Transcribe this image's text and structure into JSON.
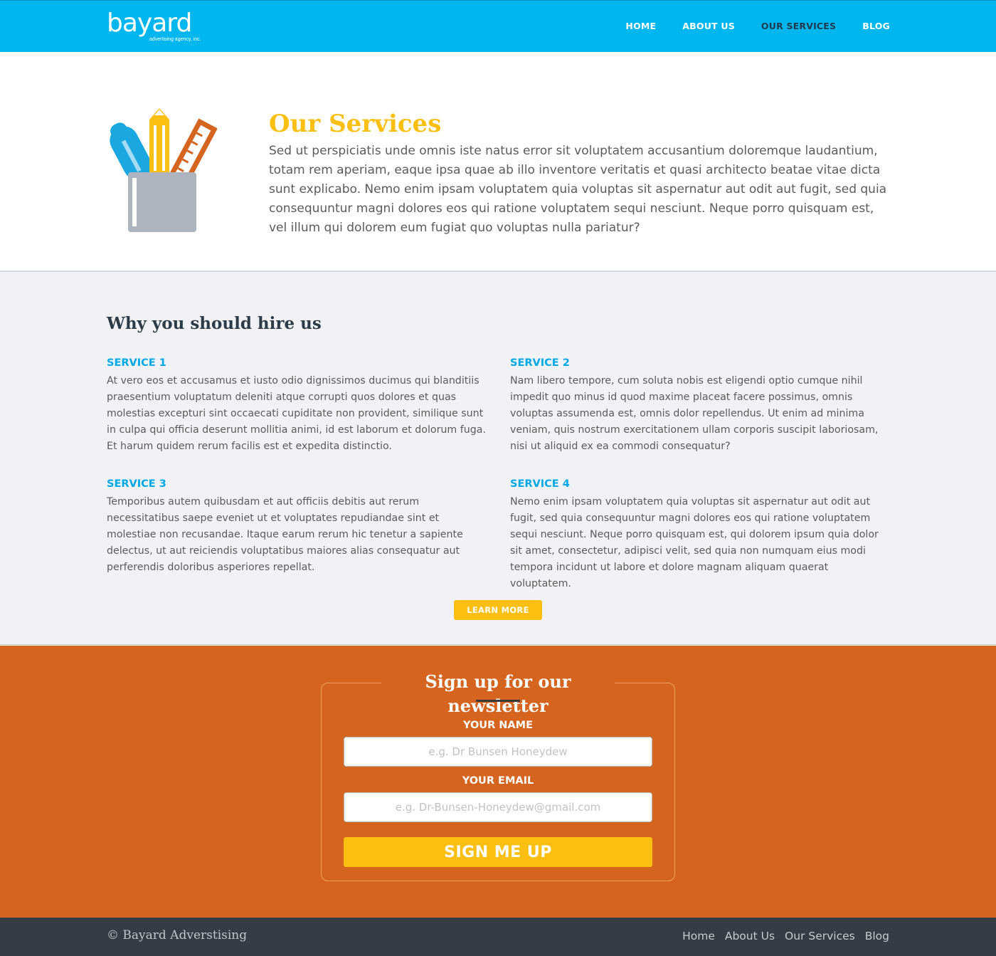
{
  "header": {
    "logo_word": "bayard",
    "logo_tagline": "advertising agency, inc.",
    "nav": [
      {
        "label": "HOME"
      },
      {
        "label": "ABOUT US"
      },
      {
        "label": "OUR SERVICES"
      },
      {
        "label": "BLOG"
      }
    ],
    "active_nav": "OUR SERVICES"
  },
  "hero": {
    "icon": "pencil-ruler-cup-icon",
    "title": "Our Services",
    "text": "Sed ut perspiciatis unde omnis iste natus error sit voluptatem accusantium doloremque laudantium, totam rem aperiam, eaque ipsa quae ab illo inventore veritatis et quasi architecto beatae vitae dicta sunt explica­bo. Nemo enim ipsam voluptatem quia voluptas sit aspernatur aut odit aut fugit, sed quia consequuntur magni dolores eos qui ratione voluptatem sequi nesciunt. Neque porro quisquam est, vel illum qui dolorem eum fugiat quo voluptas nulla pariatur?"
  },
  "services": {
    "heading": "Why you should hire us",
    "items": [
      {
        "title": "SERVICE 1",
        "text": "At vero eos et accusamus et iusto odio dignissimos ducimus qui blanditiis praesentium voluptatum deleniti atque corrupti quos dolores et quas molestias excepturi sint occaecati cupiditate non provident, similique sunt in culpa qui officia deserunt mollitia animi, id est laborum et dolorum fuga. Et harum quidem rerum facilis est et expedita distinctio."
      },
      {
        "title": "SERVICE 2",
        "text": "Nam libero tempore, cum soluta nobis est eligendi optio cumque nihil impedit quo minus id quod maxime placeat facere possimus, omnis voluptas assumenda est, omnis dolor repellendus. Ut enim ad minima veniam, quis nostrum exercitationem ullam corporis suscipit laboriosam, nisi ut aliquid ex ea commodi consequatur?"
      },
      {
        "title": "SERVICE 3",
        "text": "Temporibus autem quibusdam et aut officiis debitis aut rerum necessitatibus saepe eveniet ut et voluptates repudiandae sint et molestiae non recusandae. Itaque earum rerum hic tenetur a sapiente delectus, ut aut reiciendis voluptatibus maiores alias consequatur aut perferendis doloribus asperiores repellat."
      },
      {
        "title": "SERVICE 4",
        "text": "Nemo enim ipsam voluptatem quia voluptas sit aspernatur aut odit aut fugit, sed quia consequuntur magni dolores eos qui ratione voluptatem sequi nesciunt. Neque porro quisquam est, qui dolorem ipsum quia dolor sit amet, consectetur, adipisci velit, sed quia non numquam eius modi tempora incidunt ut labore et dolore magnam aliquam quaerat voluptatem."
      }
    ],
    "learn_more_label": "LEARN MORE"
  },
  "newsletter": {
    "title": "Sign up for our newsletter",
    "name_label": "YOUR NAME",
    "name_placeholder": "e.g. Dr Bunsen Honeydew",
    "name_value": "",
    "email_label": "YOUR EMAIL",
    "email_placeholder": "e.g. Dr-Bunsen-Honeydew@gmail.com",
    "email_value": "",
    "submit_label": "SIGN ME UP"
  },
  "footer": {
    "copyright": "© Bayard Adverstising",
    "links": [
      {
        "label": "Home"
      },
      {
        "label": "About Us"
      },
      {
        "label": "Our Services"
      },
      {
        "label": "Blog"
      }
    ]
  },
  "colors": {
    "header_blue": "#00b6ef",
    "accent_yellow": "#fbbf12",
    "service_blue": "#00a9e6",
    "newsletter_orange": "#d5641e",
    "footer_dark": "#343d46",
    "section_gray": "#f0f2f6"
  }
}
